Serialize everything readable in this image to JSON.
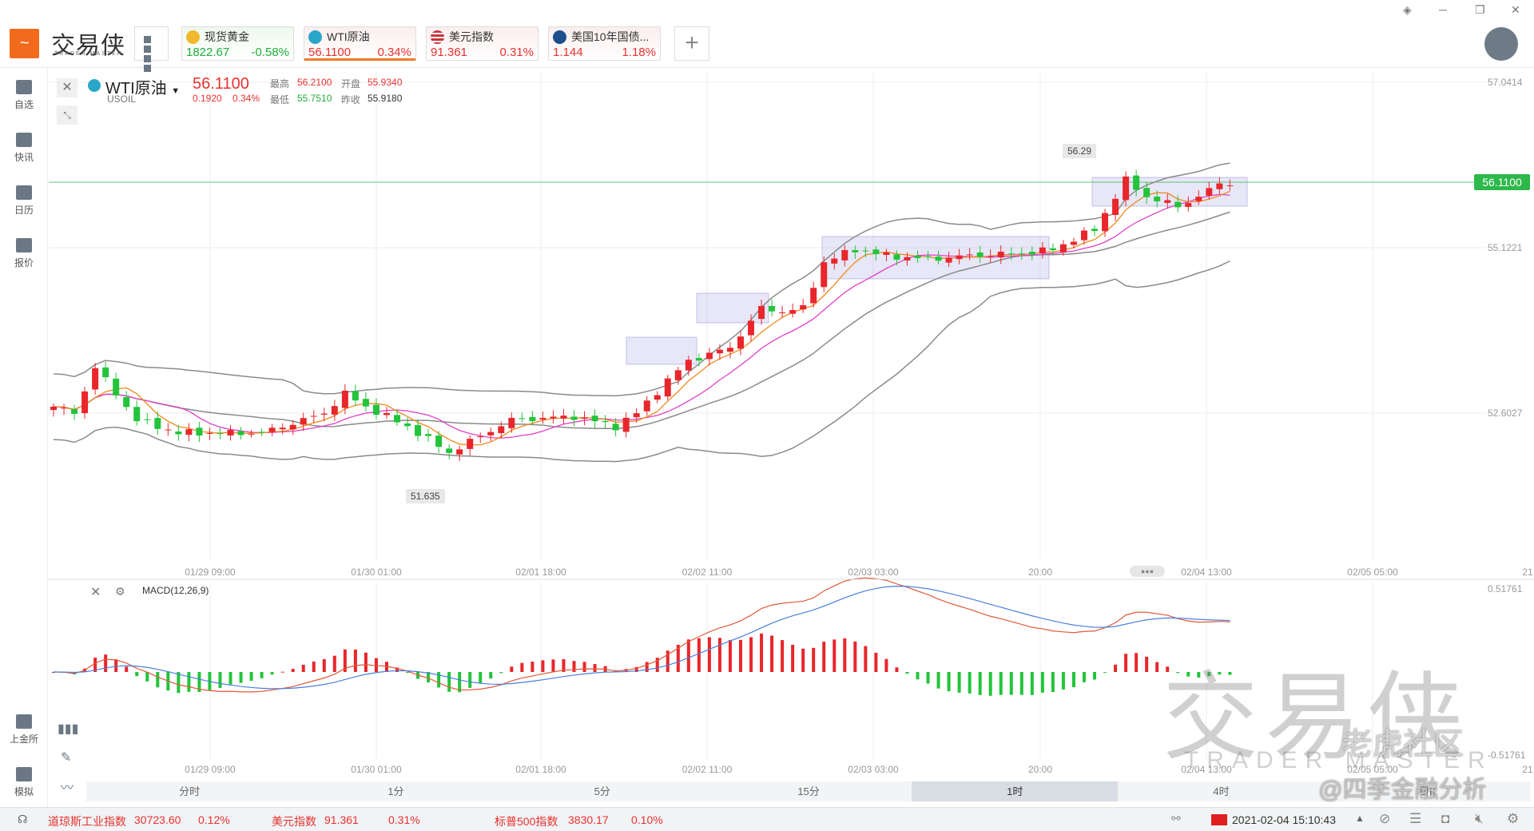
{
  "app": {
    "logo_text": "交易侠",
    "logo_sub": "TRADER MASTER"
  },
  "tickers": [
    {
      "name": "现货黄金",
      "price": "1822.67",
      "change": "-0.58%",
      "dir": "down",
      "icon": "gold-icon",
      "color": "#f1b82d"
    },
    {
      "name": "WTI原油",
      "price": "56.1100",
      "change": "0.34%",
      "dir": "up",
      "icon": "oil-icon",
      "color": "#2aa6c9"
    },
    {
      "name": "美元指数",
      "price": "91.361",
      "change": "0.31%",
      "dir": "up",
      "icon": "us-flag-icon",
      "color": "#c9343a"
    },
    {
      "name": "美国10年国债...",
      "price": "1.144",
      "change": "1.18%",
      "dir": "up",
      "icon": "bond-icon",
      "color": "#1d4f8b"
    }
  ],
  "sidebar": {
    "items": [
      {
        "label": "自选",
        "icon": "bookmark-icon"
      },
      {
        "label": "快讯",
        "icon": "news-icon"
      },
      {
        "label": "日历",
        "icon": "calendar-icon"
      },
      {
        "label": "报价",
        "icon": "quote-icon"
      }
    ],
    "bottom": [
      {
        "label": "上金所",
        "icon": "exchange-icon"
      },
      {
        "label": "模拟",
        "icon": "wallet-icon"
      }
    ]
  },
  "symbol": {
    "name": "WTI原油",
    "code": "USOIL",
    "price": "56.1100",
    "change": "0.1920",
    "change_pct": "0.34%",
    "high_label": "最高",
    "high": "56.2100",
    "open_label": "开盘",
    "open": "55.9340",
    "low_label": "最低",
    "low": "55.7510",
    "prev_label": "昨收",
    "prev": "55.9180"
  },
  "chart": {
    "price_axis": [
      "57.0414",
      "55.1221",
      "52.6027"
    ],
    "current_price": "56.1100",
    "high_marker": "56.29",
    "low_marker": "51.635",
    "time_axis": [
      "01/29 09:00",
      "01/30 01:00",
      "02/01 18:00",
      "02/02 11:00",
      "02/03 03:00",
      "20:00",
      "02/04 13:00",
      "02/05 05:00",
      "21"
    ],
    "macd_label": "MACD(12,26,9)",
    "macd_top": "0.51761",
    "macd_bottom": "-0.51761",
    "colors": {
      "up": "#e8262b",
      "down": "#22c43a",
      "ma5": "#f08a1c",
      "ma10": "#e040c8",
      "boll": "#8a8a8a",
      "dif": "#e05a3a",
      "dea": "#4a7fe0"
    }
  },
  "chart_data": {
    "type": "candlestick",
    "price_path": [
      [
        0,
        52.7
      ],
      [
        2,
        52.6
      ],
      [
        4,
        53.3
      ],
      [
        6,
        52.9
      ],
      [
        8,
        52.5
      ],
      [
        12,
        52.3
      ],
      [
        20,
        52.3
      ],
      [
        22,
        52.4
      ],
      [
        26,
        52.6
      ],
      [
        28,
        52.9
      ],
      [
        30,
        52.7
      ],
      [
        34,
        52.4
      ],
      [
        37,
        52.1
      ],
      [
        38,
        52.0
      ],
      [
        44,
        52.5
      ],
      [
        50,
        52.55
      ],
      [
        54,
        52.4
      ],
      [
        56,
        52.6
      ],
      [
        59,
        53.1
      ],
      [
        61,
        53.4
      ],
      [
        65,
        53.6
      ],
      [
        68,
        54.2
      ],
      [
        70,
        54.15
      ],
      [
        72,
        54.2
      ],
      [
        74,
        54.9
      ],
      [
        77,
        55.1
      ],
      [
        80,
        55.0
      ],
      [
        84,
        54.95
      ],
      [
        88,
        55.0
      ],
      [
        94,
        55.05
      ],
      [
        96,
        55.1
      ],
      [
        100,
        55.4
      ],
      [
        103,
        56.15
      ],
      [
        105,
        55.9
      ],
      [
        108,
        55.75
      ],
      [
        110,
        55.9
      ],
      [
        112,
        56.1
      ],
      [
        113,
        56.11
      ]
    ]
  },
  "periods": [
    "分时",
    "1分",
    "5分",
    "15分",
    "1时",
    "4时",
    "日K"
  ],
  "selected_period": "1时",
  "status": {
    "items": [
      {
        "name": "道琼斯工业指数",
        "value": "30723.60",
        "change": "0.12%"
      },
      {
        "name": "美元指数",
        "value": "91.361",
        "change": "0.31%"
      },
      {
        "name": "标普500指数",
        "value": "3830.17",
        "change": "0.10%"
      }
    ],
    "datetime": "2021-02-04 15:10:43"
  },
  "watermarks": {
    "brand": "交易侠",
    "brand_sub": "TRADER MASTER",
    "community": "老虎社区",
    "author": "@四季金融分析"
  }
}
